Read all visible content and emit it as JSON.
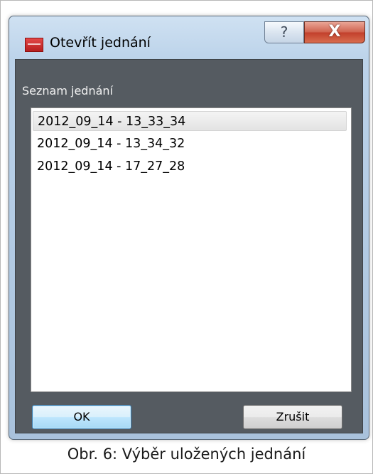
{
  "dialog": {
    "title": "Otevřít jednání",
    "help_label": "?",
    "close_label": "X"
  },
  "list": {
    "label": "Seznam jednání",
    "selected_index": 0,
    "items": [
      {
        "label": "2012_09_14 - 13_33_34"
      },
      {
        "label": "2012_09_14 - 13_34_32"
      },
      {
        "label": "2012_09_14 - 17_27_28"
      }
    ]
  },
  "buttons": {
    "ok_label": "OK",
    "cancel_label": "Zrušit"
  },
  "caption": "Obr. 6: Výběr uložených jednání",
  "colors": {
    "client_background": "#555b61",
    "title_gradient": "#bcd3ea",
    "close_button": "#c2402c",
    "ok_button_border": "#3c7fb1"
  }
}
